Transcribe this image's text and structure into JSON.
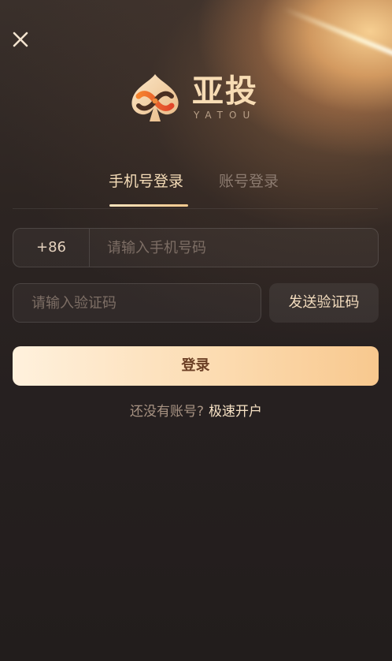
{
  "app": {
    "name": "亚投",
    "subtitle": "YATOU"
  },
  "icons": {
    "close": "close-icon",
    "logo": "spade-logo-icon"
  },
  "colors": {
    "accent": "#f6ddb8",
    "button_gradient_start": "#fff1dd",
    "button_gradient_end": "#f8c88e",
    "inactive_tab": "#8c7b70"
  },
  "tabs": [
    {
      "label": "手机号登录",
      "active": true
    },
    {
      "label": "账号登录",
      "active": false
    }
  ],
  "form": {
    "country_code": "+86",
    "phone_placeholder": "请输入手机号码",
    "phone_value": "",
    "code_placeholder": "请输入验证码",
    "code_value": "",
    "send_code_label": "发送验证码",
    "login_label": "登录"
  },
  "register": {
    "prompt": "还没有账号?",
    "link_label": "极速开户"
  }
}
